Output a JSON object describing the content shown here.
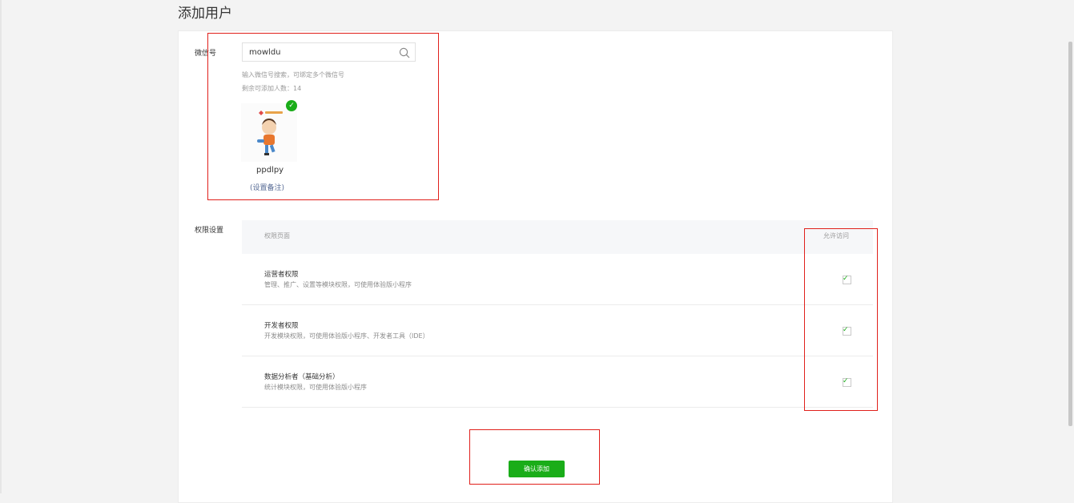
{
  "page": {
    "title": "添加用户"
  },
  "wechat": {
    "label": "微信号",
    "search_value": "mowldu",
    "hint": "输入微信号搜索，可绑定多个微信号",
    "remaining": "剩余可添加人数：14",
    "user_name": "ppdlpy",
    "remark_link": "(设置备注)"
  },
  "permissions": {
    "label": "权限设置",
    "header_page": "权限页面",
    "header_access": "允许访问",
    "rows": [
      {
        "title": "运营者权限",
        "desc": "管理、推广、设置等模块权限，可使用体验版小程序",
        "checked": true
      },
      {
        "title": "开发者权限",
        "desc": "开发模块权限，可使用体验版小程序、开发者工具（IDE）",
        "checked": true
      },
      {
        "title": "数据分析者（基础分析）",
        "desc": "统计模块权限，可使用体验版小程序",
        "checked": true
      }
    ]
  },
  "confirm_label": "确认添加",
  "icons": {
    "search": "search-icon",
    "check": "check-icon",
    "selected": "selected-check-badge-icon"
  },
  "colors": {
    "accent": "#1aad19",
    "link": "#576b95",
    "annotation": "#e0201b"
  }
}
